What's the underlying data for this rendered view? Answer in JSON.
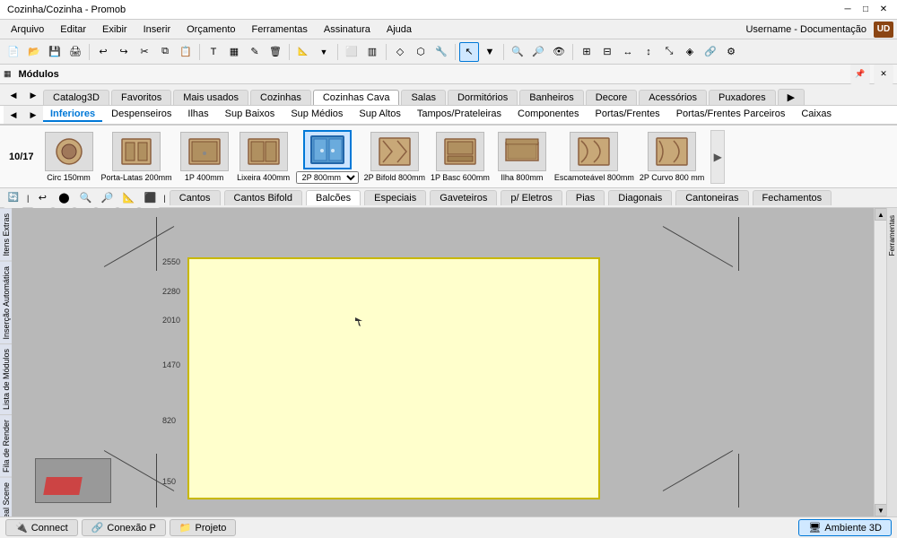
{
  "title": "Cozinha/Cozinha - Promob",
  "titlebar": {
    "title": "Cozinha/Cozinha - Promob",
    "min": "─",
    "max": "□",
    "close": "✕"
  },
  "menu": {
    "items": [
      "Arquivo",
      "Editar",
      "Exibir",
      "Inserir",
      "Orçamento",
      "Ferramentas",
      "Assinatura",
      "Ajuda"
    ]
  },
  "user": "Username - Documentação",
  "modules_title": "Módulos",
  "cat_tabs": [
    "Catalog3D",
    "Favoritos",
    "Mais usados",
    "Cozinhas",
    "Cozinhas Cava",
    "Salas",
    "Dormitórios",
    "Banheiros",
    "Decore",
    "Acessórios",
    "Puxadores"
  ],
  "active_cat": "Cozinhas Cava",
  "sub_tabs": [
    "Inferiores",
    "Despenseiros",
    "Ilhas",
    "Sup Baixos",
    "Sup Médios",
    "Sup Altos",
    "Tampos/Prateleiras",
    "Componentes",
    "Portas/Frentes",
    "Portas/Frentes Parceiros",
    "Caixas"
  ],
  "active_sub": "Inferiores",
  "pagination": "10/17",
  "thumbnails": [
    {
      "label": "Circ 150mm",
      "type": "circ"
    },
    {
      "label": "Porta-Latas 200mm",
      "type": "portalatas"
    },
    {
      "label": "1P 400mm",
      "type": "1p400"
    },
    {
      "label": "Lixeira 400mm",
      "type": "lixeira"
    },
    {
      "label": "2P 800mm",
      "type": "2p800",
      "selected": true
    },
    {
      "label": "2P Bifold 800mm",
      "type": "2pbifold"
    },
    {
      "label": "1P Basc 600mm",
      "type": "1pbasc"
    },
    {
      "label": "Ilha 800mm",
      "type": "ilha"
    },
    {
      "label": "Escamoteável 800mm",
      "type": "escamotavel"
    },
    {
      "label": "2P Curvo 800 mm",
      "type": "2pcurvo"
    }
  ],
  "bottom_tabs": [
    "Cantos",
    "Cantos Bifold",
    "Balcões",
    "Especiais",
    "Gaveteiros",
    "p/ Eletros",
    "Pias",
    "Diagonais",
    "Cantoneiras",
    "Fechamentos"
  ],
  "active_btm": "Balcões",
  "rulers": [
    "2550",
    "2280",
    "2010",
    "1470",
    "820",
    "150"
  ],
  "left_vtabs": [
    "Itens Extras",
    "Inserção Automática",
    "Lista de Módulos",
    "Fila de Render",
    "Real Scene"
  ],
  "status_btns": [
    "Connect",
    "Conexão P",
    "Projeto",
    "Ambiente 3D"
  ],
  "active_status": "Ambiente 3D"
}
